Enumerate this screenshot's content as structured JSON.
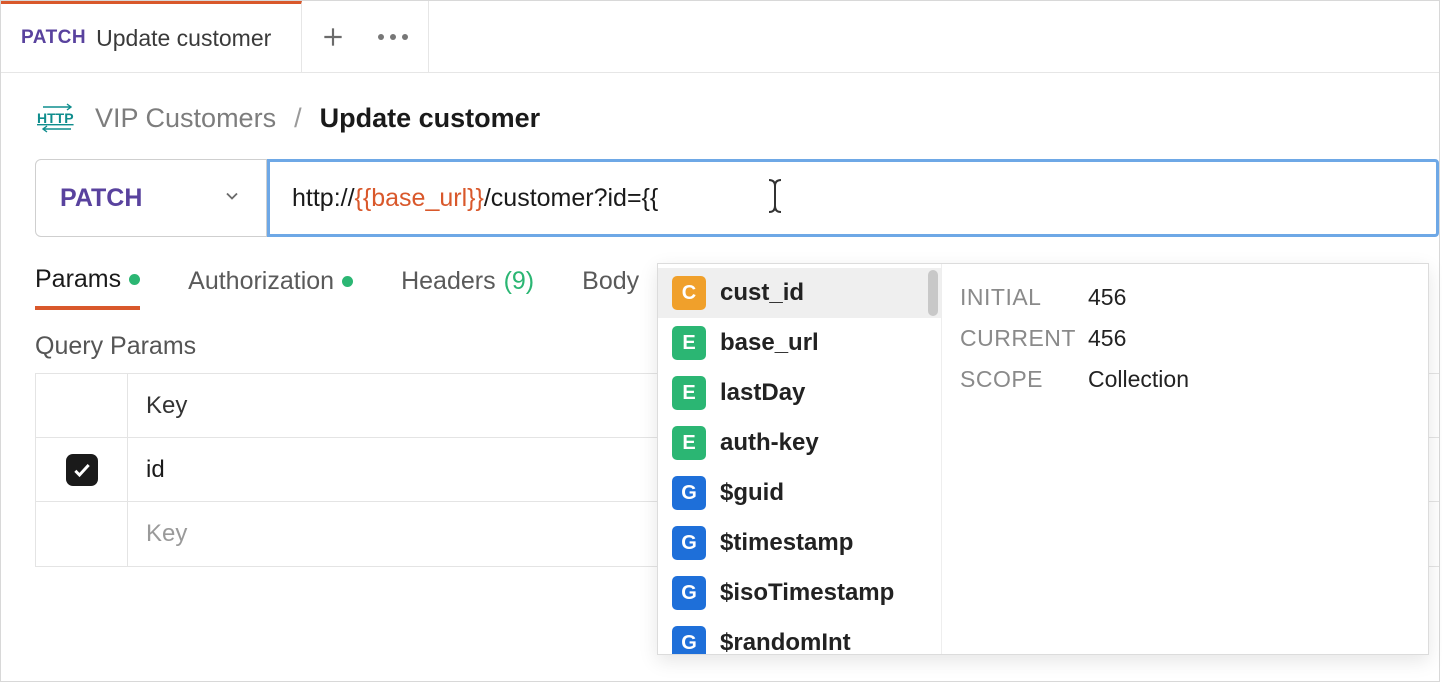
{
  "tabs": {
    "active": {
      "method": "PATCH",
      "title": "Update customer"
    }
  },
  "breadcrumb": {
    "collection": "VIP Customers",
    "current": "Update customer"
  },
  "request": {
    "method": "PATCH",
    "url_prefix": "http://",
    "url_var": "{{base_url}}",
    "url_suffix": "/customer?id={{"
  },
  "subtabs": {
    "params": "Params",
    "auth": "Authorization",
    "headers": "Headers",
    "headers_count": "(9)",
    "body": "Body"
  },
  "query_params": {
    "title": "Query Params",
    "header_key": "Key",
    "rows": [
      {
        "checked": true,
        "key": "id"
      }
    ],
    "placeholder_key": "Key"
  },
  "autocomplete": {
    "items": [
      {
        "badge": "C",
        "label": "cust_id",
        "selected": true
      },
      {
        "badge": "E",
        "label": "base_url"
      },
      {
        "badge": "E",
        "label": "lastDay"
      },
      {
        "badge": "E",
        "label": "auth-key"
      },
      {
        "badge": "G",
        "label": "$guid"
      },
      {
        "badge": "G",
        "label": "$timestamp"
      },
      {
        "badge": "G",
        "label": "$isoTimestamp"
      },
      {
        "badge": "G",
        "label": "$randomInt"
      }
    ],
    "detail": {
      "initial_label": "INITIAL",
      "initial_value": "456",
      "current_label": "CURRENT",
      "current_value": "456",
      "scope_label": "SCOPE",
      "scope_value": "Collection"
    }
  }
}
